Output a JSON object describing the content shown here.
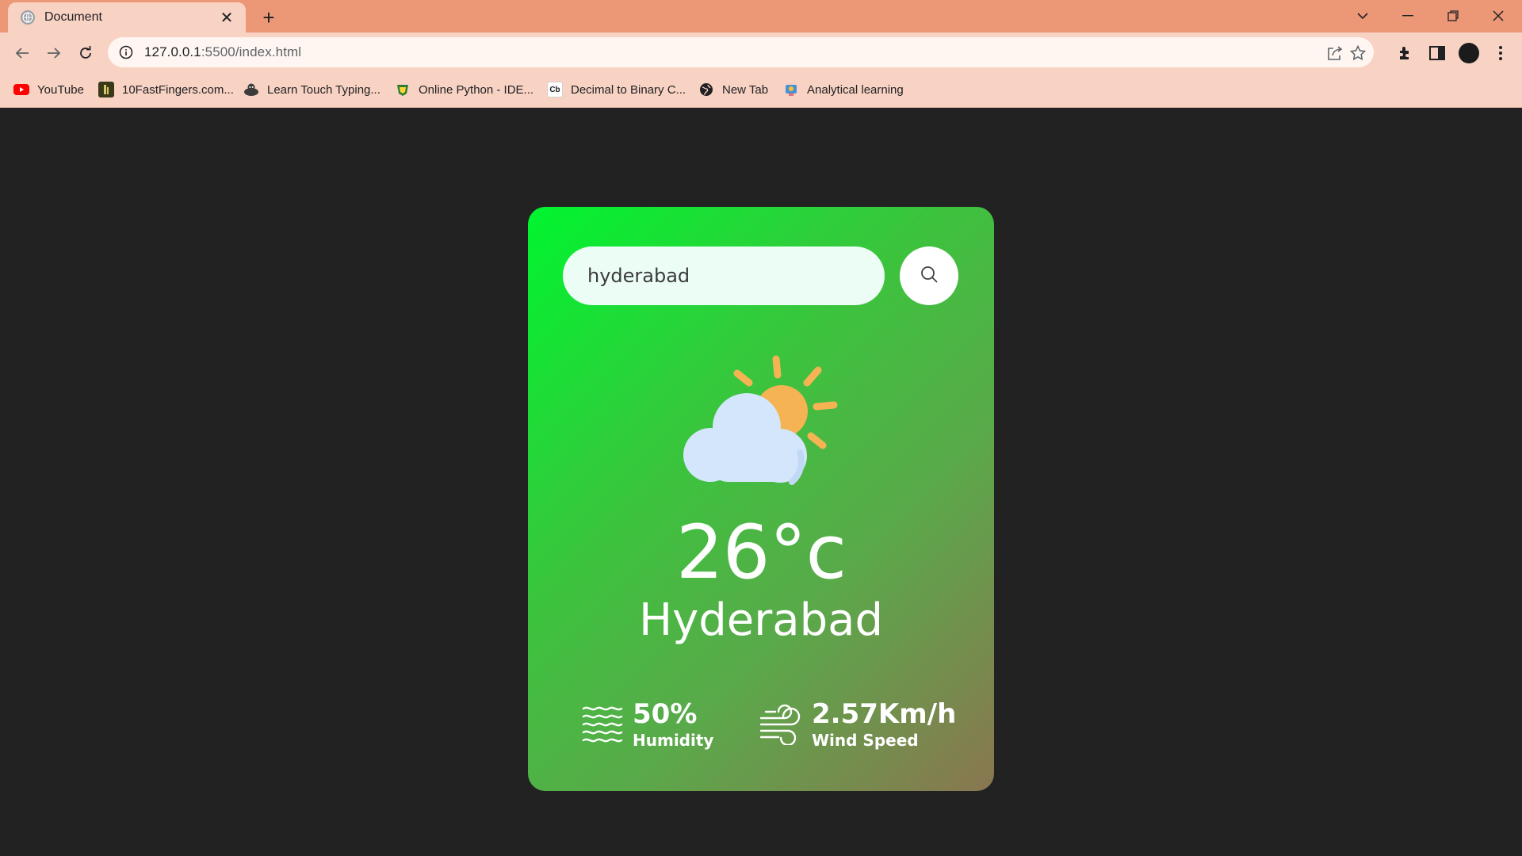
{
  "browser": {
    "tab": {
      "title": "Document",
      "close_glyph": "✕"
    },
    "new_tab_glyph": "+",
    "url": {
      "host": "127.0.0.1",
      "path": ":5500/index.html"
    },
    "bookmarks": [
      {
        "label": "YouTube",
        "icon": "youtube-icon",
        "color": "#ff0000"
      },
      {
        "label": "10FastFingers.com...",
        "icon": "10fastfingers-icon",
        "color": "#3a3a1a"
      },
      {
        "label": "Learn Touch Typing...",
        "icon": "typing-icon",
        "color": "#3c3c3c"
      },
      {
        "label": "Online Python - IDE...",
        "icon": "python-ide-icon",
        "color": "#2e7d32"
      },
      {
        "label": "Decimal to Binary C...",
        "icon": "cb-icon",
        "glyph": "Cb",
        "color": "#ffffff"
      },
      {
        "label": "New Tab",
        "icon": "globe-icon",
        "color": "#202124"
      },
      {
        "label": "Analytical learning",
        "icon": "analytical-icon",
        "color": "#4a90d9"
      }
    ]
  },
  "weather": {
    "search": {
      "value": "hyderabad"
    },
    "temperature": "26°c",
    "city": "Hyderabad",
    "humidity": {
      "value": "50%",
      "label": "Humidity"
    },
    "wind": {
      "value": "2.57Km/h",
      "label": "Wind Speed"
    },
    "condition_icon": "partly-cloudy-icon"
  },
  "colors": {
    "chrome_tabbar": "#ec9776",
    "chrome_toolbar": "#f8d2c3",
    "page_bg": "#222222",
    "card_gradient": [
      "#00f52f",
      "#3dc23e",
      "#5aa94a",
      "#8a7650"
    ],
    "sun": "#f5b354",
    "cloud": "#d3e6fb"
  }
}
